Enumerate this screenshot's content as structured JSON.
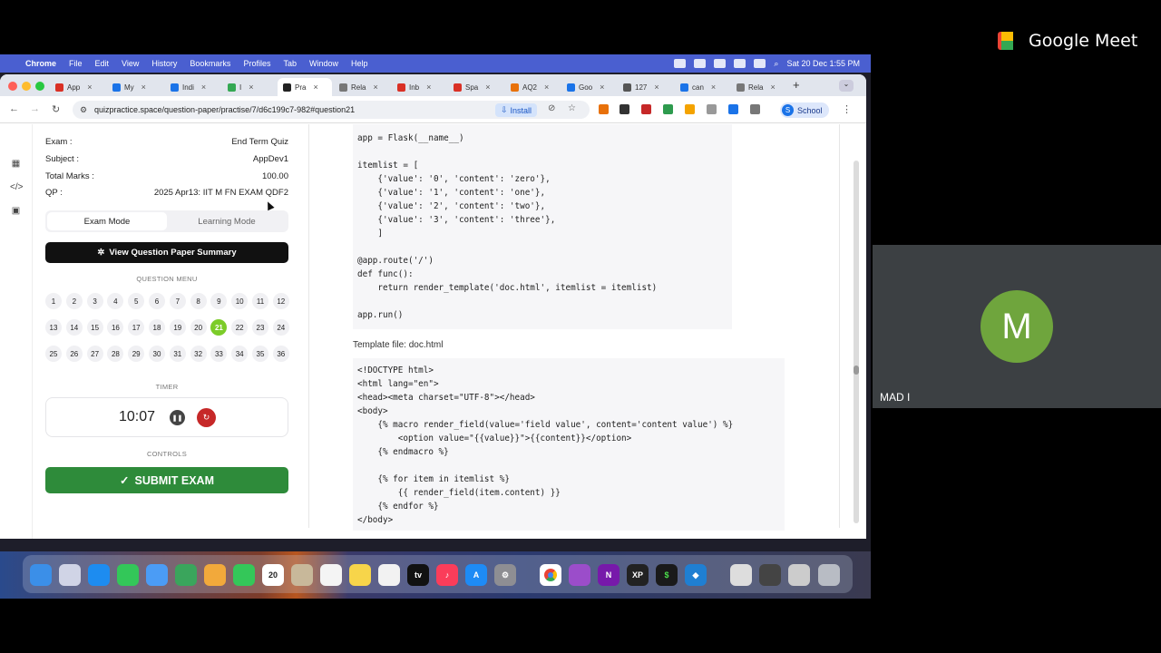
{
  "meet": {
    "app_name": "Google Meet",
    "participant_initial": "M",
    "participant_name": "MAD I",
    "avatar_color": "#6fa53d"
  },
  "menubar": {
    "app": "Chrome",
    "items": [
      "File",
      "Edit",
      "View",
      "History",
      "Bookmarks",
      "Profiles",
      "Tab",
      "Window",
      "Help"
    ],
    "datetime": "Sat 20 Dec  1:55 PM"
  },
  "tabs": [
    {
      "label": "App",
      "color": "#d93025"
    },
    {
      "label": "My",
      "color": "#1a73e8"
    },
    {
      "label": "Indi",
      "color": "#1a73e8"
    },
    {
      "label": "I",
      "color": "#34a853"
    },
    {
      "label": "Pra",
      "color": "#222222",
      "active": true
    },
    {
      "label": "Rela",
      "color": "#777777"
    },
    {
      "label": "Inb",
      "color": "#d93025"
    },
    {
      "label": "Spa",
      "color": "#d93025"
    },
    {
      "label": "AQ2",
      "color": "#e8710a"
    },
    {
      "label": "Goo",
      "color": "#1a73e8"
    },
    {
      "label": "127",
      "color": "#555555"
    },
    {
      "label": "can",
      "color": "#1a73e8"
    },
    {
      "label": "Rela",
      "color": "#777777"
    }
  ],
  "toolbar": {
    "url": "quizpractice.space/question-paper/practise/7/d6c199c7-982#question21",
    "install_label": "Install",
    "profile_initial": "S",
    "profile_label": "School"
  },
  "exam_info": {
    "exam_label": "Exam :",
    "exam_value": "End Term Quiz",
    "subject_label": "Subject :",
    "subject_value": "AppDev1",
    "marks_label": "Total Marks :",
    "marks_value": "100.00",
    "qp_label": "QP :",
    "qp_value": "2025 Apr13: IIT M FN EXAM QDF2"
  },
  "modes": {
    "exam": "Exam Mode",
    "learning": "Learning Mode"
  },
  "summary_button": "View Question Paper Summary",
  "question_menu": {
    "label": "QUESTION MENU",
    "numbers": [
      1,
      2,
      3,
      4,
      5,
      6,
      7,
      8,
      9,
      10,
      11,
      12,
      13,
      14,
      15,
      16,
      17,
      18,
      19,
      20,
      21,
      22,
      23,
      24,
      25,
      26,
      27,
      28,
      29,
      30,
      31,
      32,
      33,
      34,
      35,
      36
    ],
    "current": 21
  },
  "timer": {
    "label": "TIMER",
    "value": "10:07"
  },
  "controls": {
    "label": "CONTROLS",
    "submit": "SUBMIT EXAM"
  },
  "question": {
    "code_python": "app = Flask(__name__)\n\nitemlist = [\n    {'value': '0', 'content': 'zero'},\n    {'value': '1', 'content': 'one'},\n    {'value': '2', 'content': 'two'},\n    {'value': '3', 'content': 'three'},\n    ]\n\n@app.route('/')\ndef func():\n    return render_template('doc.html', itemlist = itemlist)\n\napp.run()",
    "template_label": "Template file: doc.html",
    "code_template": "<!DOCTYPE html>\n<html lang=\"en\">\n<head><meta charset=\"UTF-8\"></head>\n<body>\n    {% macro render_field(value='field value', content='content value') %}\n        <option value=\"{{value}}\">{{content}}</option>\n    {% endmacro %}\n\n    {% for item in itemlist %}\n        {{ render_field(item.content) }}\n    {% endfor %}\n</body>"
  },
  "dock": {
    "calendar_day": "20"
  }
}
